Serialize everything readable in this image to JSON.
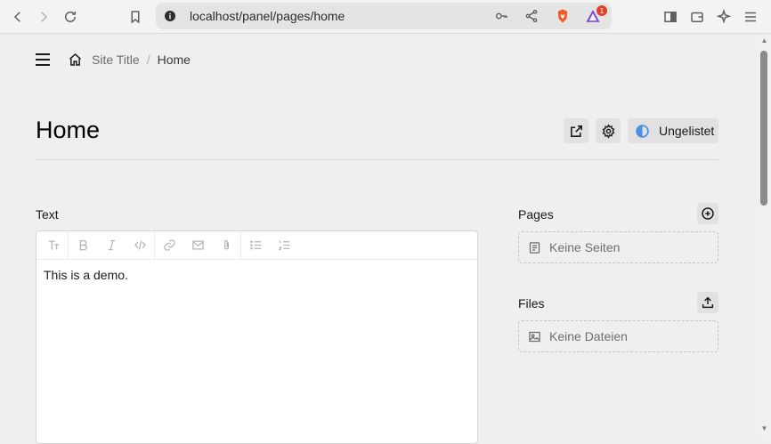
{
  "browser": {
    "url": "localhost/panel/pages/home",
    "notification_count": "1"
  },
  "breadcrumb": {
    "items": [
      "Site Title",
      "Home"
    ]
  },
  "header": {
    "title": "Home",
    "status_label": "Ungelistet"
  },
  "text_field": {
    "label": "Text",
    "content": "This is a demo."
  },
  "pages_section": {
    "label": "Pages",
    "empty_text": "Keine Seiten"
  },
  "files_section": {
    "label": "Files",
    "empty_text": "Keine Dateien"
  },
  "colors": {
    "background": "#efefef",
    "status_accent": "#4a90e2"
  }
}
